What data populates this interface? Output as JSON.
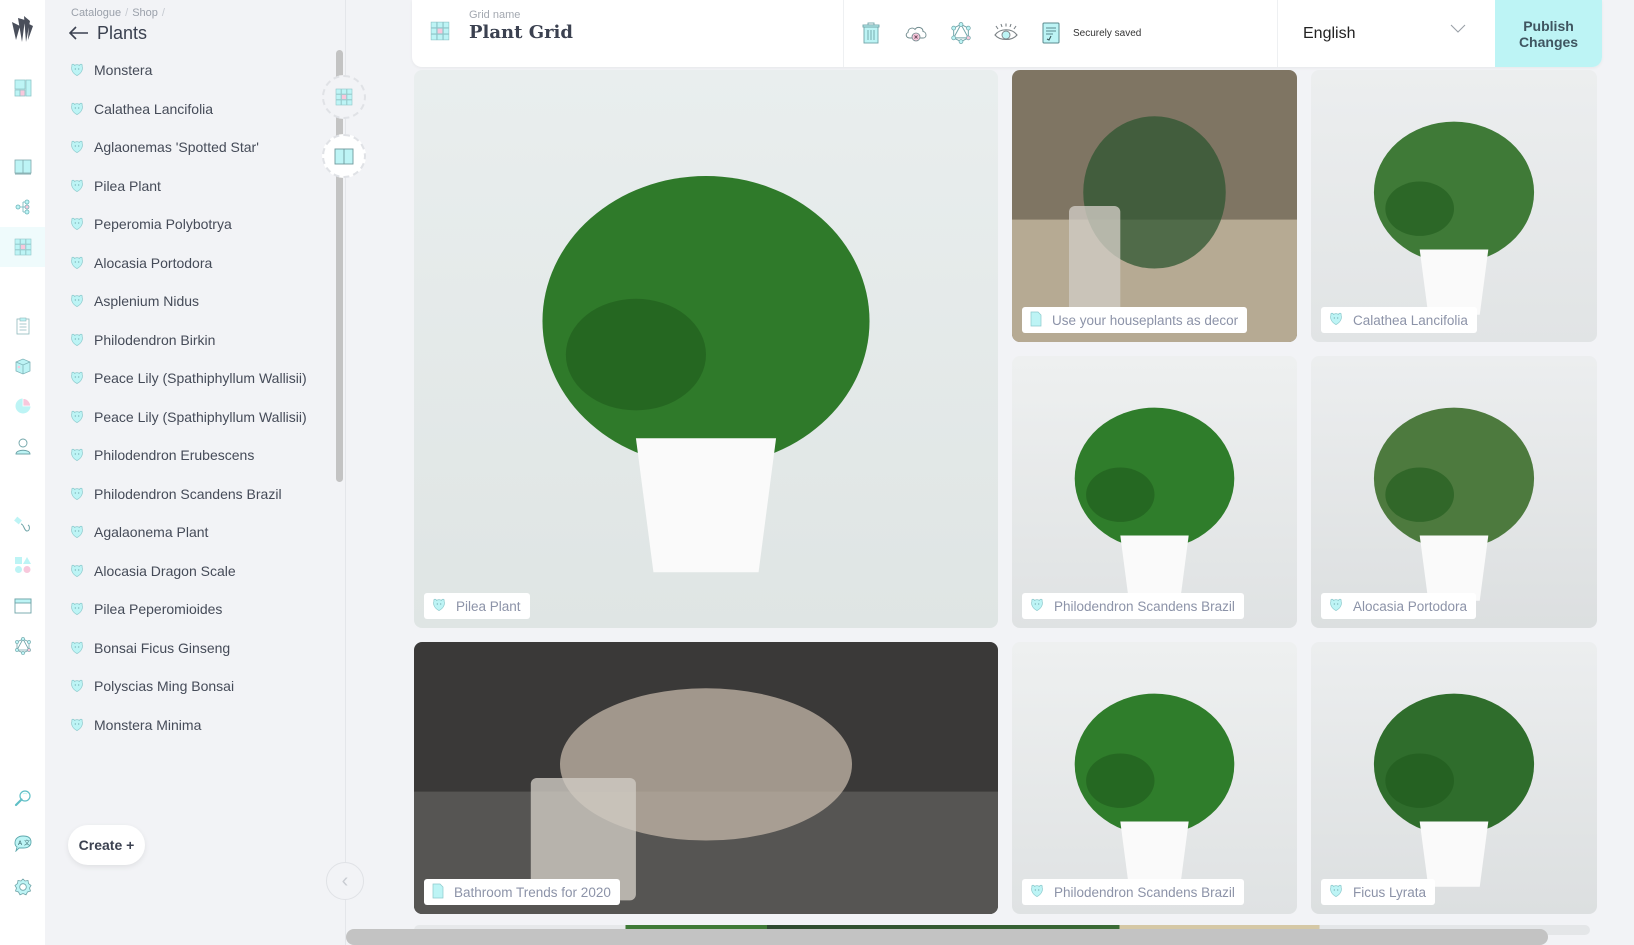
{
  "rail": {
    "items": [
      {
        "name": "dashboard-icon"
      },
      {
        "name": "book-icon"
      },
      {
        "name": "hierarchy-icon"
      },
      {
        "name": "grid-icon",
        "active": true
      },
      {
        "name": "clipboard-icon"
      },
      {
        "name": "box-icon"
      },
      {
        "name": "pie-chart-icon"
      },
      {
        "name": "user-icon"
      },
      {
        "name": "hook-icon"
      },
      {
        "name": "shapes-icon"
      },
      {
        "name": "window-icon"
      },
      {
        "name": "network-icon"
      },
      {
        "name": "search-icon"
      },
      {
        "name": "translate-icon"
      },
      {
        "name": "settings-icon"
      }
    ]
  },
  "panel": {
    "breadcrumb": [
      "Catalogue",
      "Shop"
    ],
    "title": "Plants",
    "items": [
      "Monstera",
      "Calathea Lancifolia",
      "Aglaonemas 'Spotted Star'",
      "Pilea Plant",
      "Peperomia Polybotrya",
      "Alocasia Portodora",
      "Asplenium Nidus",
      "Philodendron Birkin",
      "Peace Lily (Spathiphyllum Wallisii)",
      "Peace Lily (Spathiphyllum Wallisii)",
      "Philodendron Erubescens",
      "Philodendron Scandens Brazil",
      "Agalaonema Plant",
      "Alocasia Dragon Scale",
      "Pilea Peperomioides",
      "Bonsai Ficus Ginseng",
      "Polyscias Ming Bonsai",
      "Monstera Minima"
    ],
    "create_label": "Create +",
    "collapse_icon": "‹"
  },
  "header": {
    "grid_label": "Grid name",
    "grid_name": "Plant Grid",
    "saved_status": "Securely saved",
    "language": "English",
    "publish_label": "Publish Changes"
  },
  "grid": {
    "tiles": [
      {
        "label": "Pilea Plant",
        "kind": "product",
        "colors": [
          "#e9eeee",
          "#dfe5e4",
          "#2f7a2a"
        ]
      },
      {
        "label": "Use your houseplants as decor",
        "kind": "article",
        "colors": [
          "#7f7563",
          "#b6aa93",
          "#2e5530"
        ]
      },
      {
        "label": "Calathea Lancifolia",
        "kind": "product",
        "colors": [
          "#eceeef",
          "#e1e4e5",
          "#3f7a37"
        ]
      },
      {
        "label": "Philodendron Scandens Brazil",
        "kind": "product",
        "colors": [
          "#eef0f0",
          "#dfe2e3",
          "#2f7d2b"
        ]
      },
      {
        "label": "Alocasia Portodora",
        "kind": "product",
        "colors": [
          "#eceeef",
          "#dcdfe0",
          "#4d7a3e"
        ]
      },
      {
        "label": "Bathroom Trends for 2020",
        "kind": "article",
        "colors": [
          "#3a3938",
          "#565553",
          "#c4b7a8"
        ]
      },
      {
        "label": "Philodendron Scandens Brazil",
        "kind": "product",
        "colors": [
          "#eef0f0",
          "#dfe2e3",
          "#2f7d2b"
        ]
      },
      {
        "label": "Ficus Lyrata",
        "kind": "product",
        "colors": [
          "#eceeef",
          "#dcdfe0",
          "#2f6d2c"
        ]
      }
    ]
  },
  "theme": {
    "accent": "#bdf4f5",
    "accent_pink": "#f8c8dc"
  }
}
